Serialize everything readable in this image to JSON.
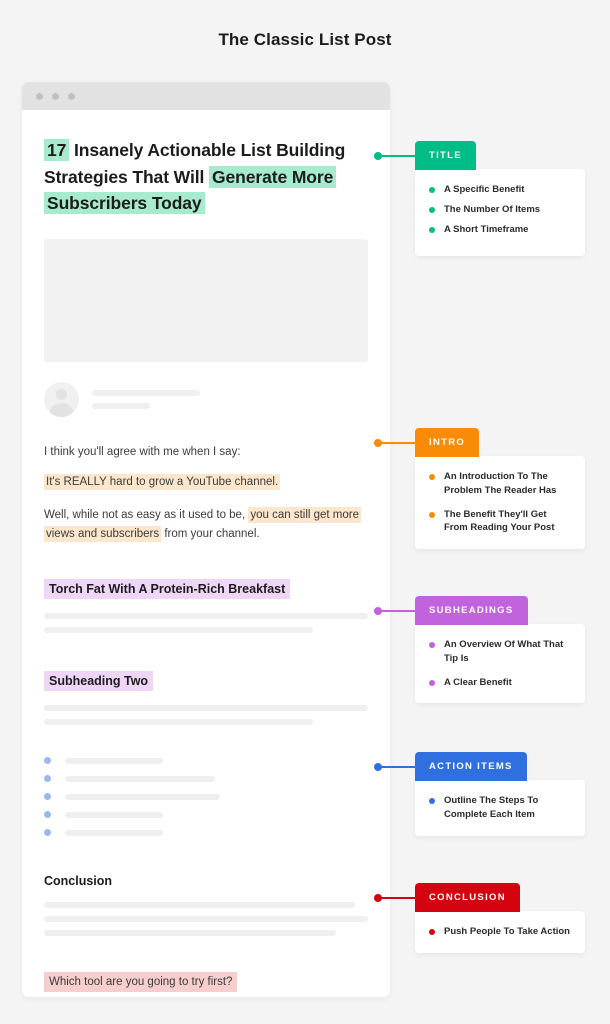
{
  "page": {
    "title": "The Classic List Post"
  },
  "colors": {
    "title_accent": "#00bd87",
    "intro_accent": "#f98b07",
    "subheadings_accent": "#c063dd",
    "action_accent": "#2f6fe0",
    "conclusion_accent": "#d3030f",
    "title_highlight": "#a6ebcd",
    "intro_highlight": "#fce7cd",
    "subhead_highlight": "#efd6f7",
    "conclusion_highlight": "#f6cecd"
  },
  "browser": {
    "dots": [
      "window-dot-1",
      "window-dot-2",
      "window-dot-3"
    ]
  },
  "article": {
    "headline": {
      "number": "17",
      "mid": " Insanely Actionable List Building Strategies That Will ",
      "tail": "Generate More Subscribers Today"
    },
    "intro": {
      "line1": "I think you'll agree with me when I say:",
      "line2": "It's REALLY hard to grow a YouTube channel.",
      "line3_pre": "Well, while not as easy as it used to be, ",
      "line3_hl": "you can still get more views and subscribers",
      "line3_post": " from your channel."
    },
    "subheading_one": "Torch Fat With A Protein-Rich Breakfast",
    "subheading_two": "Subheading Two",
    "conclusion_heading": "Conclusion",
    "conclusion_question": "Which tool are you going to try first?"
  },
  "callouts": [
    {
      "label": "TITLE",
      "color": "#00bd87",
      "items": [
        "A Specific Benefit",
        "The Number Of Items",
        "A Short Timeframe"
      ]
    },
    {
      "label": "INTRO",
      "color": "#f98b07",
      "items": [
        "An Introduction To The Problem The Reader Has",
        "The Benefit They'll Get From Reading Your Post"
      ]
    },
    {
      "label": "SUBHEADINGS",
      "color": "#c063dd",
      "items": [
        "An Overview Of What That Tip Is",
        "A Clear Benefit"
      ]
    },
    {
      "label": "ACTION ITEMS",
      "color": "#2f6fe0",
      "items": [
        "Outline The Steps To Complete Each Item"
      ]
    },
    {
      "label": "CONCLUSION",
      "color": "#d3030f",
      "items": [
        "Push People To Take Action"
      ]
    }
  ]
}
